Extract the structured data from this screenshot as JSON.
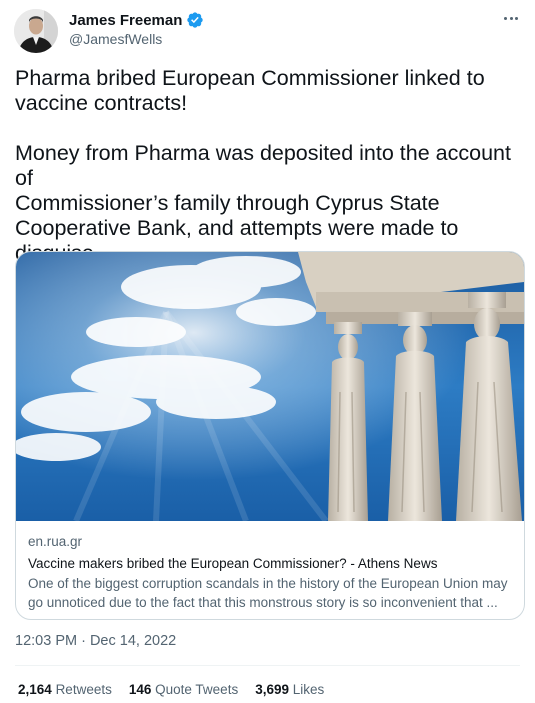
{
  "author": {
    "display_name": "James Freeman",
    "handle": "@JamesfWells",
    "verified_icon": "verified-badge-icon",
    "badge_color": "#1d9bf0"
  },
  "tweet": {
    "text": "Pharma bribed European Commissioner linked to\nvaccine contracts!\n\nMoney from Pharma was deposited into the account of\nCommissioner’s family through Cyprus State\nCooperative Bank, and attempts were made to disguise\nthe transfer as a loan",
    "timestamp": "12:03 PM · Dec 14, 2022"
  },
  "link_card": {
    "domain": "en.rua.gr",
    "title": "Vaccine makers bribed the European Commissioner? - Athens News",
    "description": "One of the biggest corruption scandals in the history of the European Union may go unnoticed due to the fact that this monstrous story is so inconvenient that ..."
  },
  "stats": {
    "retweets_count": "2,164",
    "retweets_label": "Retweets",
    "quotes_count": "146",
    "quotes_label": "Quote Tweets",
    "likes_count": "3,699",
    "likes_label": "Likes"
  },
  "colors": {
    "text_primary": "#0f1419",
    "text_secondary": "#536471",
    "border": "#cfd9de"
  }
}
